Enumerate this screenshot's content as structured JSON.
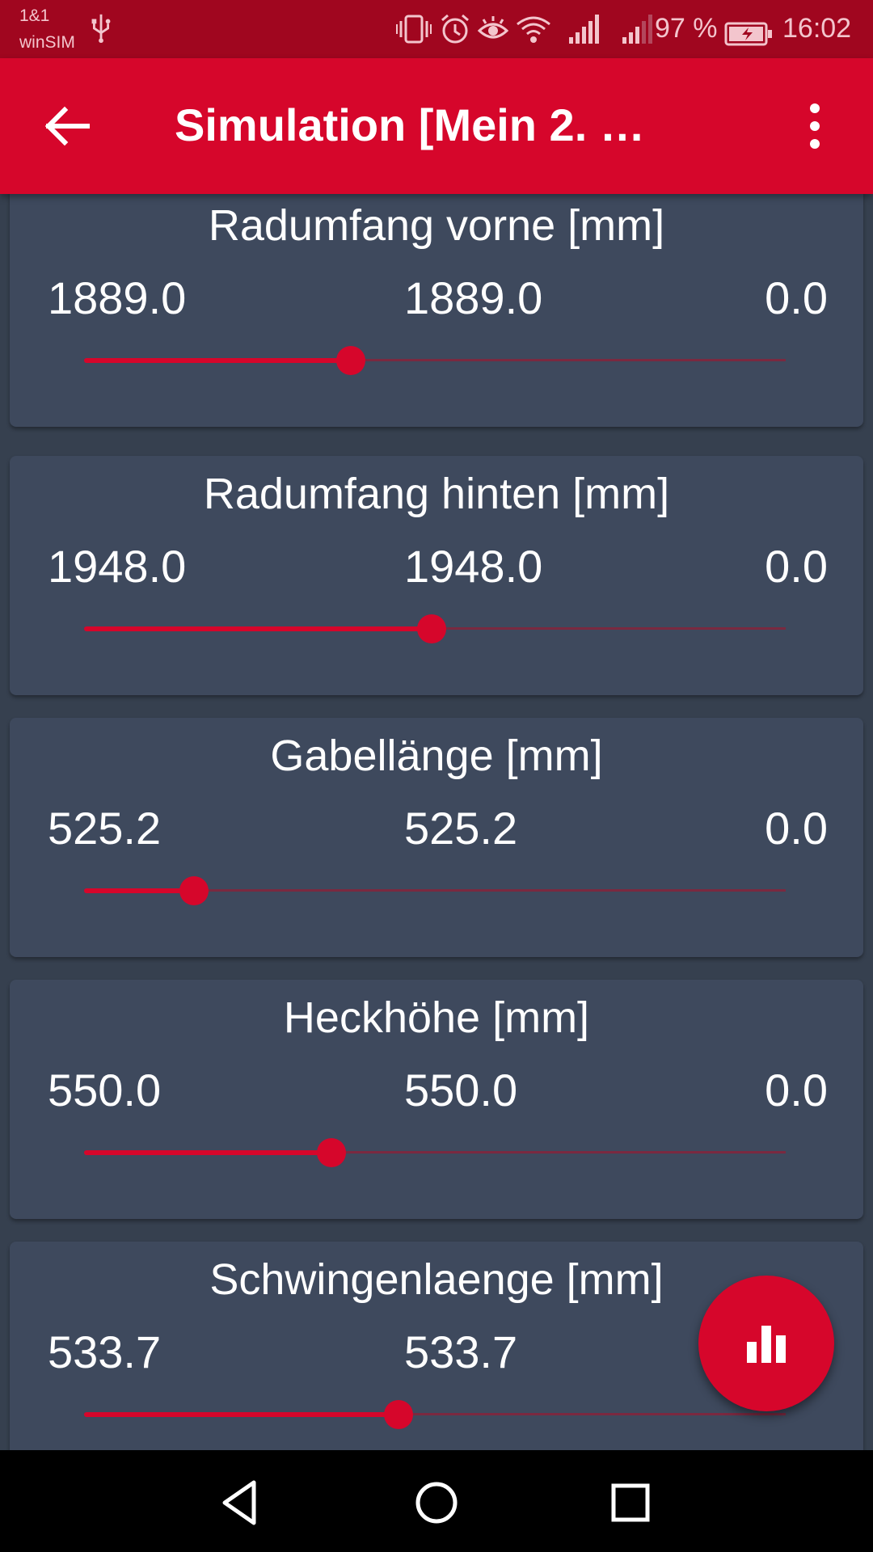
{
  "status_bar": {
    "carrier_line1": "1&1",
    "carrier_line2": "winSIM",
    "battery_percent": "97 %",
    "time": "16:02",
    "icons": [
      "usb-icon",
      "vibrate-icon",
      "alarm-icon",
      "eye-comfort-icon",
      "wifi-icon",
      "signal-icon",
      "signal-icon-2",
      "battery-charging-icon"
    ]
  },
  "toolbar": {
    "title": "Simulation [Mein 2. …",
    "back_icon": "arrow-back-icon",
    "more_icon": "more-vert-icon"
  },
  "accent_color": "#d6062b",
  "cards": [
    {
      "title": "Radumfang vorne [mm]",
      "value_left": "1889.0",
      "value_mid": "1889.0",
      "value_right": "0.0",
      "slider_fraction": 0.38
    },
    {
      "title": "Radumfang hinten [mm]",
      "value_left": "1948.0",
      "value_mid": "1948.0",
      "value_right": "0.0",
      "slider_fraction": 0.495
    },
    {
      "title": "Gabellänge [mm]",
      "value_left": "525.2",
      "value_mid": "525.2",
      "value_right": "0.0",
      "slider_fraction": 0.157
    },
    {
      "title": "Heckhöhe [mm]",
      "value_left": "550.0",
      "value_mid": "550.0",
      "value_right": "0.0",
      "slider_fraction": 0.352
    },
    {
      "title": "Schwingenlaenge [mm]",
      "value_left": "533.7",
      "value_mid": "533.7",
      "value_right": "",
      "slider_fraction": 0.448
    }
  ],
  "fab": {
    "icon": "bar-chart-icon"
  },
  "nav_bar": {
    "icons": [
      "back-triangle-icon",
      "home-circle-icon",
      "recents-square-icon"
    ]
  }
}
